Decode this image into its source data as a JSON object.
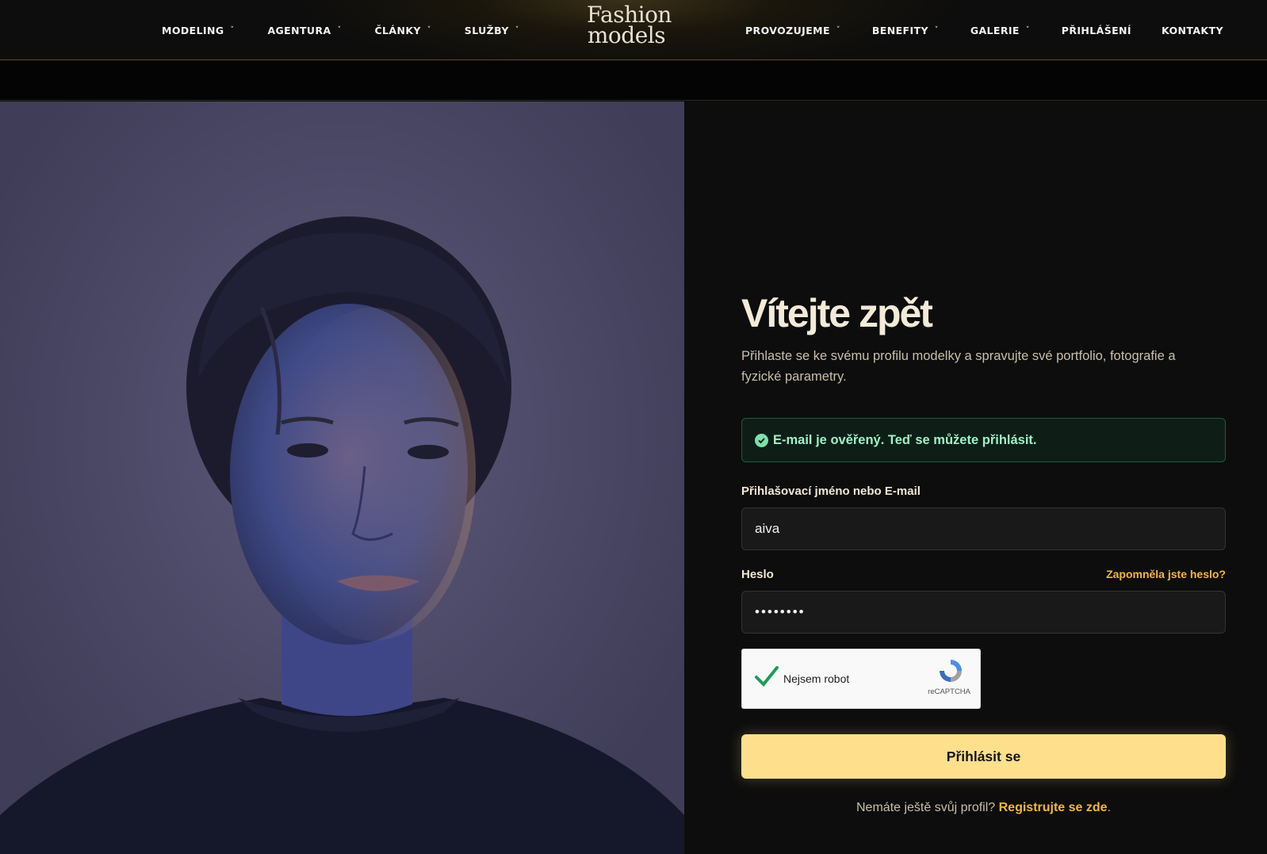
{
  "nav": {
    "left": [
      {
        "label": "MODELING",
        "caret": "˅"
      },
      {
        "label": "AGENTURA",
        "caret": "˅"
      },
      {
        "label": "ČLÁNKY",
        "caret": "˅"
      },
      {
        "label": "SLUŽBY",
        "caret": "˅"
      }
    ],
    "right": [
      {
        "label": "PROVOZUJEME",
        "caret": "˅"
      },
      {
        "label": "BENEFITY",
        "caret": "˅"
      },
      {
        "label": "GALERIE",
        "caret": "˅"
      },
      {
        "label": "PŘIHLÁŠENÍ"
      },
      {
        "label": "KONTAKTY"
      }
    ]
  },
  "logo": {
    "line1": "Fashion",
    "line2": "models"
  },
  "login": {
    "title": "Vítejte zpět",
    "subtitle": "Přihlaste se ke svému profilu modelky a spravujte své portfolio, fotografie a fyzické parametry.",
    "alert": "E-mail je ověřený. Teď se můžete přihlásit.",
    "username_label": "Přihlašovací jméno nebo E-mail",
    "username_value": "aiva",
    "password_label": "Heslo",
    "password_value": "••••••••",
    "forgot": "Zapomněla jste heslo?",
    "captcha_text": "Nejsem robot",
    "captcha_brand": "reCAPTCHA",
    "submit": "Přihlásit se",
    "register_prefix": "Nemáte ještě svůj profil? ",
    "register_link": "Registrujte se zde",
    "register_suffix": "."
  },
  "colors": {
    "accent": "#fedf8c",
    "link": "#f5b53a",
    "success": "#9ff0c6"
  }
}
